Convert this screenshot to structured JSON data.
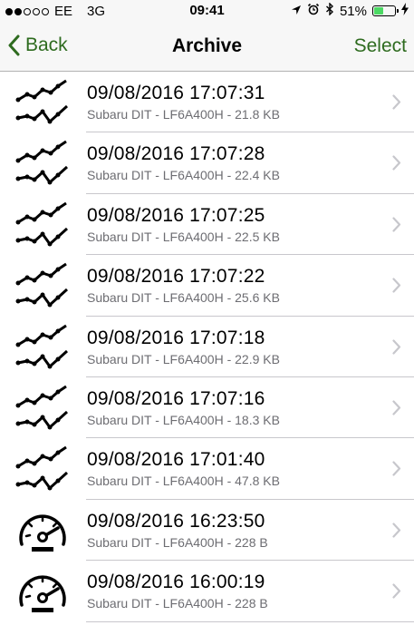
{
  "status_bar": {
    "carrier": "EE",
    "network": "3G",
    "time": "09:41",
    "battery": "51%",
    "battery_level": 0.51,
    "signal_bars": 2,
    "signal_total": 5,
    "icons": [
      "location-icon",
      "alarm-icon",
      "bluetooth-icon",
      "battery-icon",
      "charging-icon"
    ]
  },
  "nav": {
    "back_label": "Back",
    "title": "Archive",
    "select_label": "Select"
  },
  "colors": {
    "accent": "#2e6b1f",
    "battery_fill": "#4cd964",
    "separator": "#c8c7cc",
    "subtitle": "#6d6d72"
  },
  "items": [
    {
      "title": "09/08/2016 17:07:31",
      "subtitle": "Subaru DIT - LF6A400H - 21.8 KB",
      "icon": "graph-icon"
    },
    {
      "title": "09/08/2016 17:07:28",
      "subtitle": "Subaru DIT - LF6A400H - 22.4 KB",
      "icon": "graph-icon"
    },
    {
      "title": "09/08/2016 17:07:25",
      "subtitle": "Subaru DIT - LF6A400H - 22.5 KB",
      "icon": "graph-icon"
    },
    {
      "title": "09/08/2016 17:07:22",
      "subtitle": "Subaru DIT - LF6A400H - 25.6 KB",
      "icon": "graph-icon"
    },
    {
      "title": "09/08/2016 17:07:18",
      "subtitle": "Subaru DIT - LF6A400H - 22.9 KB",
      "icon": "graph-icon"
    },
    {
      "title": "09/08/2016 17:07:16",
      "subtitle": "Subaru DIT - LF6A400H - 18.3 KB",
      "icon": "graph-icon"
    },
    {
      "title": "09/08/2016 17:01:40",
      "subtitle": "Subaru DIT - LF6A400H - 47.8 KB",
      "icon": "graph-icon"
    },
    {
      "title": "09/08/2016 16:23:50",
      "subtitle": "Subaru DIT - LF6A400H - 228 B",
      "icon": "gauge-icon"
    },
    {
      "title": "09/08/2016 16:00:19",
      "subtitle": "Subaru DIT - LF6A400H - 228 B",
      "icon": "gauge-icon"
    }
  ]
}
